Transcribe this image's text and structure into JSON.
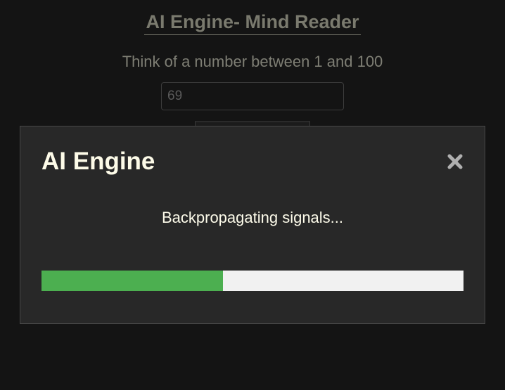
{
  "page": {
    "title": "AI Engine- Mind Reader",
    "prompt": "Think of a number between 1 and 100",
    "number_input": {
      "value": "69"
    }
  },
  "modal": {
    "title": "AI Engine",
    "close_icon": "close-icon",
    "status_text": "Backpropagating signals...",
    "progress_fraction": 0.43,
    "progress_color": "#4caf50",
    "progress_track_color": "#f1f1f1"
  }
}
